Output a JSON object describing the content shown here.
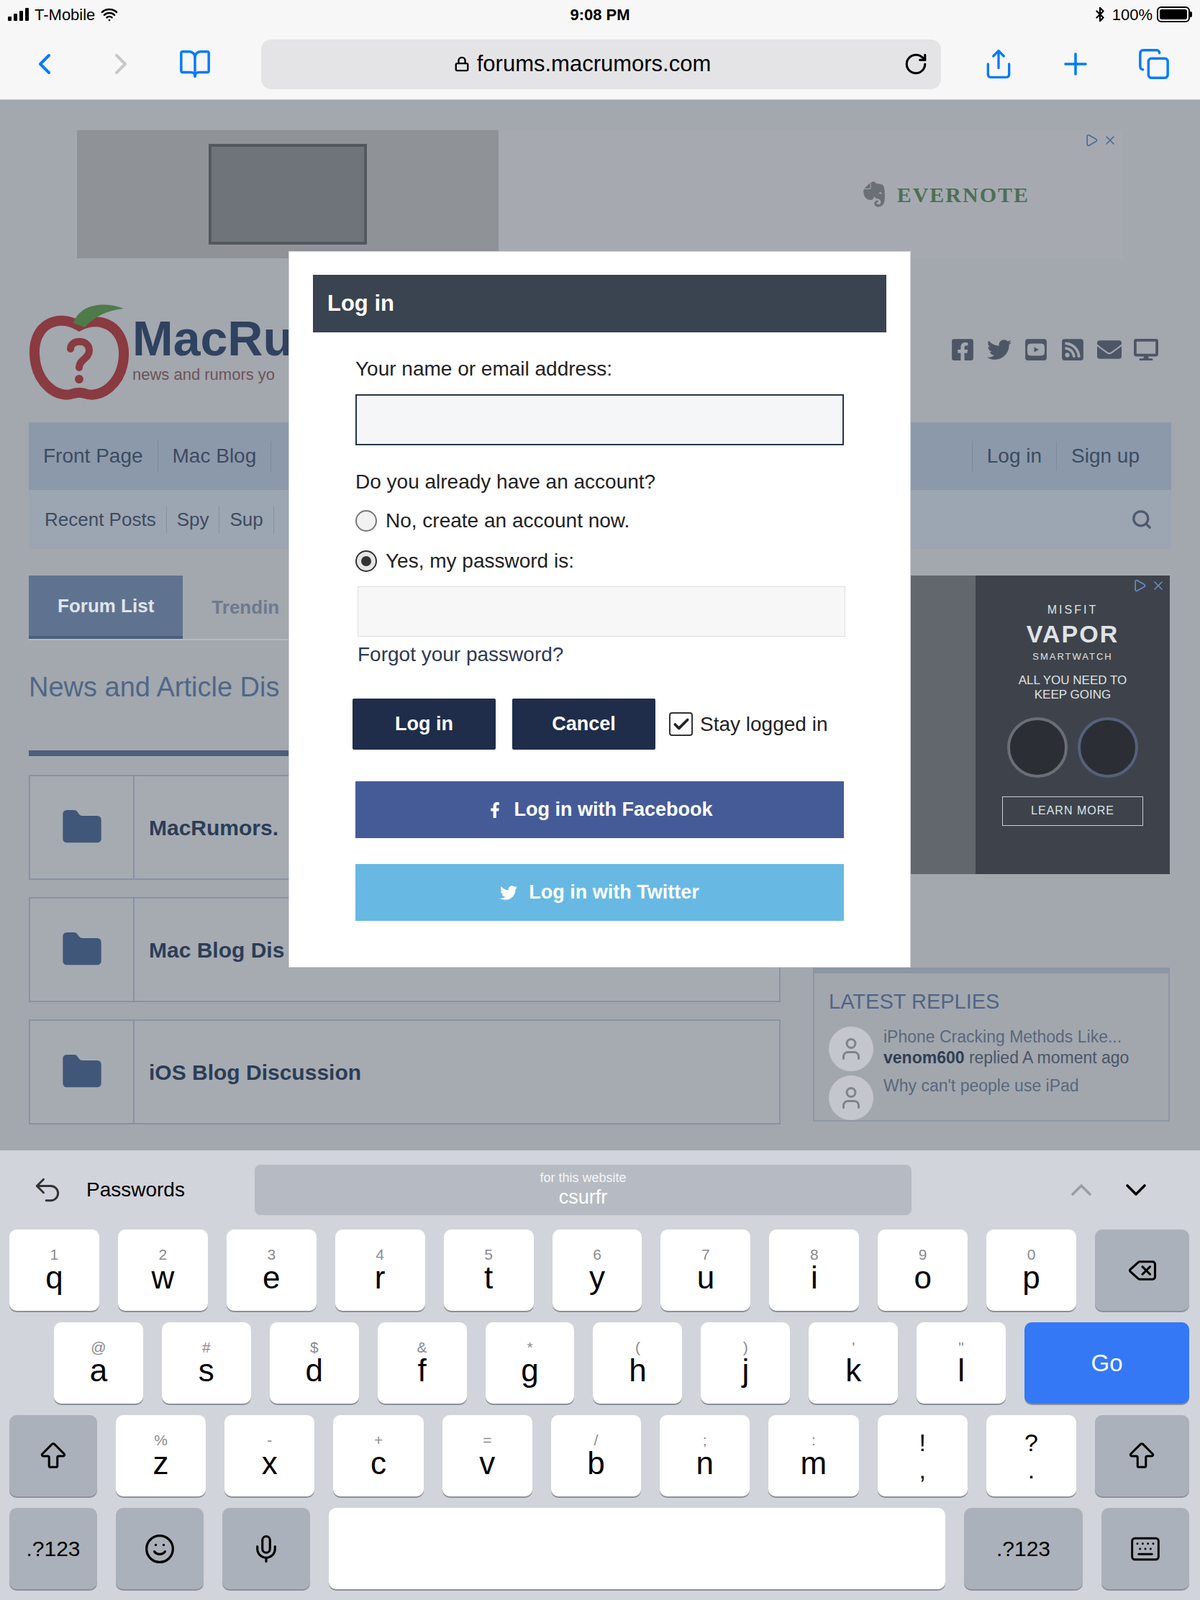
{
  "status_bar": {
    "carrier": "T-Mobile",
    "time": "9:08 PM",
    "battery": "100%",
    "battery_level": 1
  },
  "browser": {
    "url": "forums.macrumors.com",
    "back_enabled": true,
    "forward_enabled": false
  },
  "page": {
    "top_ad": {
      "brand": "EVERNOTE"
    },
    "logo": {
      "name": "MacRu",
      "tagline": "news and rumors yo"
    },
    "nav": {
      "left": [
        "Front Page",
        "Mac Blog"
      ],
      "right": [
        "Log in",
        "Sign up"
      ]
    },
    "subnav": [
      "Recent Posts",
      "Spy",
      "Sup"
    ],
    "tabs": [
      {
        "label": "Forum List",
        "selected": true
      },
      {
        "label": "Trendin",
        "selected": false
      }
    ],
    "section_title": "News and Article Dis",
    "forums": [
      "MacRumors.",
      "Mac Blog Dis",
      "iOS Blog Discussion"
    ],
    "side_ad": {
      "brand": "MISFIT",
      "product": "VAPOR",
      "subtitle": "SMARTWATCH",
      "tagline": "ALL YOU NEED TO KEEP GOING",
      "button": "LEARN MORE"
    },
    "latest_replies": {
      "title": "LATEST REPLIES",
      "items": [
        {
          "thread": "iPhone Cracking Methods Like...",
          "user": "venom600",
          "action": "replied A moment ago"
        },
        {
          "thread": "Why can't people use iPad",
          "user": "",
          "action": ""
        }
      ]
    }
  },
  "dialog": {
    "title": "Log in",
    "name_label": "Your name or email address:",
    "name_value": "",
    "name_focused": true,
    "account_question": "Do you already have an account?",
    "options": [
      {
        "label": "No, create an account now.",
        "selected": false
      },
      {
        "label": "Yes, my password is:",
        "selected": true
      }
    ],
    "password_value": "",
    "forgot": "Forgot your password?",
    "buttons": [
      "Log in",
      "Cancel"
    ],
    "stay_logged_in": {
      "label": "Stay logged in",
      "checked": true
    },
    "social": [
      {
        "kind": "facebook",
        "label": "Log in with Facebook",
        "color": "#455b98"
      },
      {
        "kind": "twitter",
        "label": "Log in with Twitter",
        "color": "#67b9e3"
      }
    ]
  },
  "keyboard": {
    "shortcut_bar": {
      "label": "Passwords",
      "suggestion_caption": "for this website",
      "suggestion": "csurfr",
      "up_enabled": false,
      "down_enabled": true
    },
    "rows": [
      [
        {
          "kind": "letter",
          "label": "q",
          "alt": "1"
        },
        {
          "kind": "letter",
          "label": "w",
          "alt": "2"
        },
        {
          "kind": "letter",
          "label": "e",
          "alt": "3"
        },
        {
          "kind": "letter",
          "label": "r",
          "alt": "4"
        },
        {
          "kind": "letter",
          "label": "t",
          "alt": "5"
        },
        {
          "kind": "letter",
          "label": "y",
          "alt": "6"
        },
        {
          "kind": "letter",
          "label": "u",
          "alt": "7"
        },
        {
          "kind": "letter",
          "label": "i",
          "alt": "8"
        },
        {
          "kind": "letter",
          "label": "o",
          "alt": "9"
        },
        {
          "kind": "letter",
          "label": "p",
          "alt": "0"
        },
        {
          "kind": "backspace",
          "label": "",
          "alt": ""
        }
      ],
      [
        {
          "kind": "letter",
          "label": "a",
          "alt": "@"
        },
        {
          "kind": "letter",
          "label": "s",
          "alt": "#"
        },
        {
          "kind": "letter",
          "label": "d",
          "alt": "$"
        },
        {
          "kind": "letter",
          "label": "f",
          "alt": "&"
        },
        {
          "kind": "letter",
          "label": "g",
          "alt": "*"
        },
        {
          "kind": "letter",
          "label": "h",
          "alt": "("
        },
        {
          "kind": "letter",
          "label": "j",
          "alt": ")"
        },
        {
          "kind": "letter",
          "label": "k",
          "alt": "'"
        },
        {
          "kind": "letter",
          "label": "l",
          "alt": "\""
        },
        {
          "kind": "go",
          "label": "Go",
          "alt": ""
        }
      ],
      [
        {
          "kind": "shift",
          "label": "",
          "alt": ""
        },
        {
          "kind": "letter",
          "label": "z",
          "alt": "%"
        },
        {
          "kind": "letter",
          "label": "x",
          "alt": "-"
        },
        {
          "kind": "letter",
          "label": "c",
          "alt": "+"
        },
        {
          "kind": "letter",
          "label": "v",
          "alt": "="
        },
        {
          "kind": "letter",
          "label": "b",
          "alt": "/"
        },
        {
          "kind": "letter",
          "label": "n",
          "alt": ";"
        },
        {
          "kind": "letter",
          "label": "m",
          "alt": ":"
        },
        {
          "kind": "punct",
          "label": ",",
          "alt": "!"
        },
        {
          "kind": "punct",
          "label": ".",
          "alt": "?"
        },
        {
          "kind": "shift",
          "label": "",
          "alt": ""
        }
      ],
      [
        {
          "kind": "mode",
          "label": ".?123",
          "alt": ""
        },
        {
          "kind": "emoji",
          "label": "",
          "alt": ""
        },
        {
          "kind": "mic",
          "label": "",
          "alt": ""
        },
        {
          "kind": "space",
          "label": "",
          "alt": ""
        },
        {
          "kind": "mode",
          "label": ".?123",
          "alt": ""
        },
        {
          "kind": "dismiss",
          "label": "",
          "alt": ""
        }
      ]
    ]
  }
}
